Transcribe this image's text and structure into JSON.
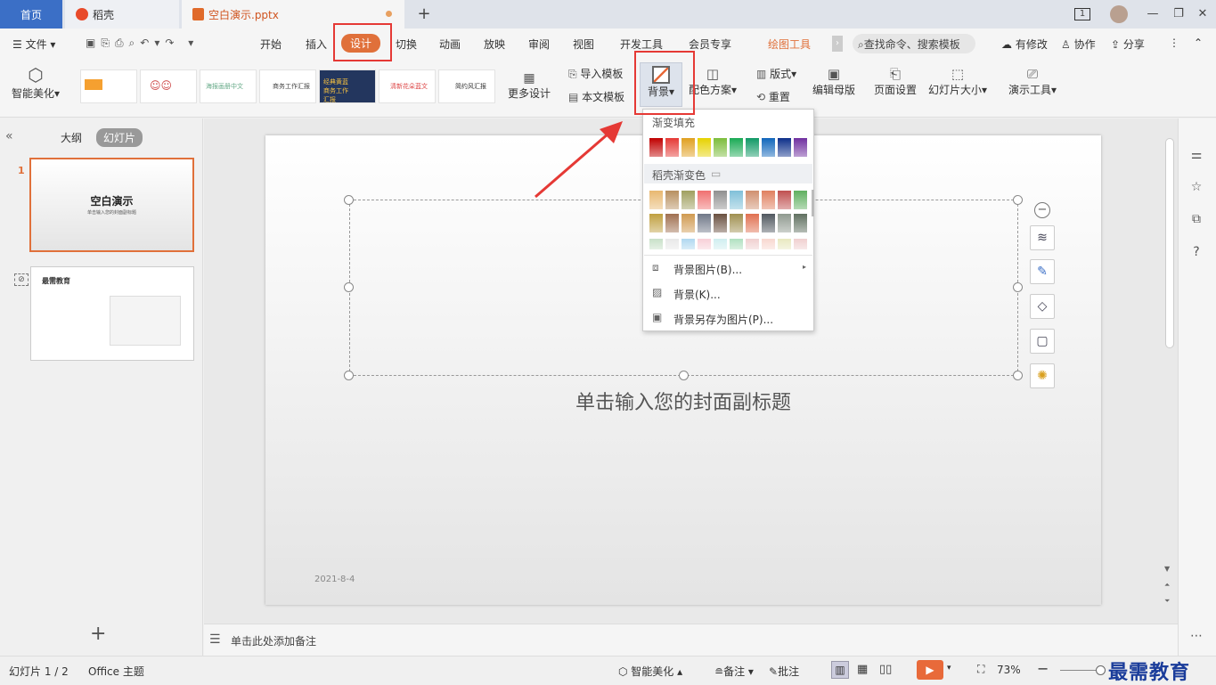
{
  "titlebar": {
    "home_tab": "首页",
    "daoke_tab": "稻壳",
    "doc_tab": "空白演示.pptx",
    "new_tab": "+",
    "page_badge": "1"
  },
  "menubar": {
    "file": "文件",
    "items": [
      "开始",
      "插入",
      "设计",
      "切换",
      "动画",
      "放映",
      "审阅",
      "视图",
      "开发工具",
      "会员专享",
      "绘图工具"
    ],
    "search_placeholder": "查找命令、搜索模板",
    "has_edit": "有修改",
    "collab": "协作",
    "share": "分享"
  },
  "ribbon": {
    "smart_beautify": "智能美化",
    "more_designs": "更多设计",
    "import_template": "导入模板",
    "this_template": "本文模板",
    "background": "背景",
    "color_scheme": "配色方案",
    "layout": "版式",
    "reset": "重置",
    "edit_master": "编辑母版",
    "page_setup": "页面设置",
    "slide_size": "幻灯片大小",
    "present_tools": "演示工具",
    "thumbs": [
      "",
      "",
      "海报画册中文",
      "商务工作汇报",
      "经典黄蓝商务工作汇报",
      "清新花朵蓝文",
      "简约风汇报"
    ]
  },
  "left": {
    "outline_tab": "大纲",
    "slides_tab": "幻灯片",
    "slide1_num": "1",
    "slide1_title": "空白演示",
    "slide1_sub": "单击输入您的封面副标题",
    "slide2_title": "最需教育",
    "add": "+"
  },
  "slide": {
    "subtitle": "单击输入您的封面副标题",
    "date": "2021-8-4"
  },
  "dropdown": {
    "gradient_fill": "渐变填充",
    "daoke_gradient": "稻壳渐变色",
    "bg_image": "背景图片(B)...",
    "bg": "背景(K)...",
    "save_bg": "背景另存为图片(P)...",
    "solid_colors": [
      "#c00000",
      "#e53935",
      "#e0a020",
      "#e6d200",
      "#7cbd3c",
      "#1aaa55",
      "#119966",
      "#1166bb",
      "#0d2f8a",
      "#7030a0"
    ],
    "grad_row1": [
      "#e8b870",
      "#b89060",
      "#a0a060",
      "#f07070",
      "#909090",
      "#80c0d8",
      "#d09070",
      "#e08060",
      "#c05050",
      "#60b060"
    ],
    "grad_row2": [
      "#c0a040",
      "#a07050",
      "#d09a50",
      "#707888",
      "#6a5040",
      "#a09050",
      "#e07050",
      "#505860",
      "#909a90",
      "#607060"
    ],
    "grad_row3": [
      "#c8e0c8",
      "#e8e8e8",
      "#b0d8f0",
      "#f8d0d8",
      "#d0eef0",
      "#b0e0c0",
      "#f0d0d0",
      "#f8d8d0",
      "#e8e8c0",
      "#f0d0d0"
    ]
  },
  "notes": {
    "placeholder": "单击此处添加备注"
  },
  "status": {
    "slide_count": "幻灯片 1 / 2",
    "theme": "Office 主题",
    "smart_beautify": "智能美化",
    "notes": "备注",
    "comments": "批注",
    "zoom": "73%",
    "watermark": "最需教育"
  }
}
